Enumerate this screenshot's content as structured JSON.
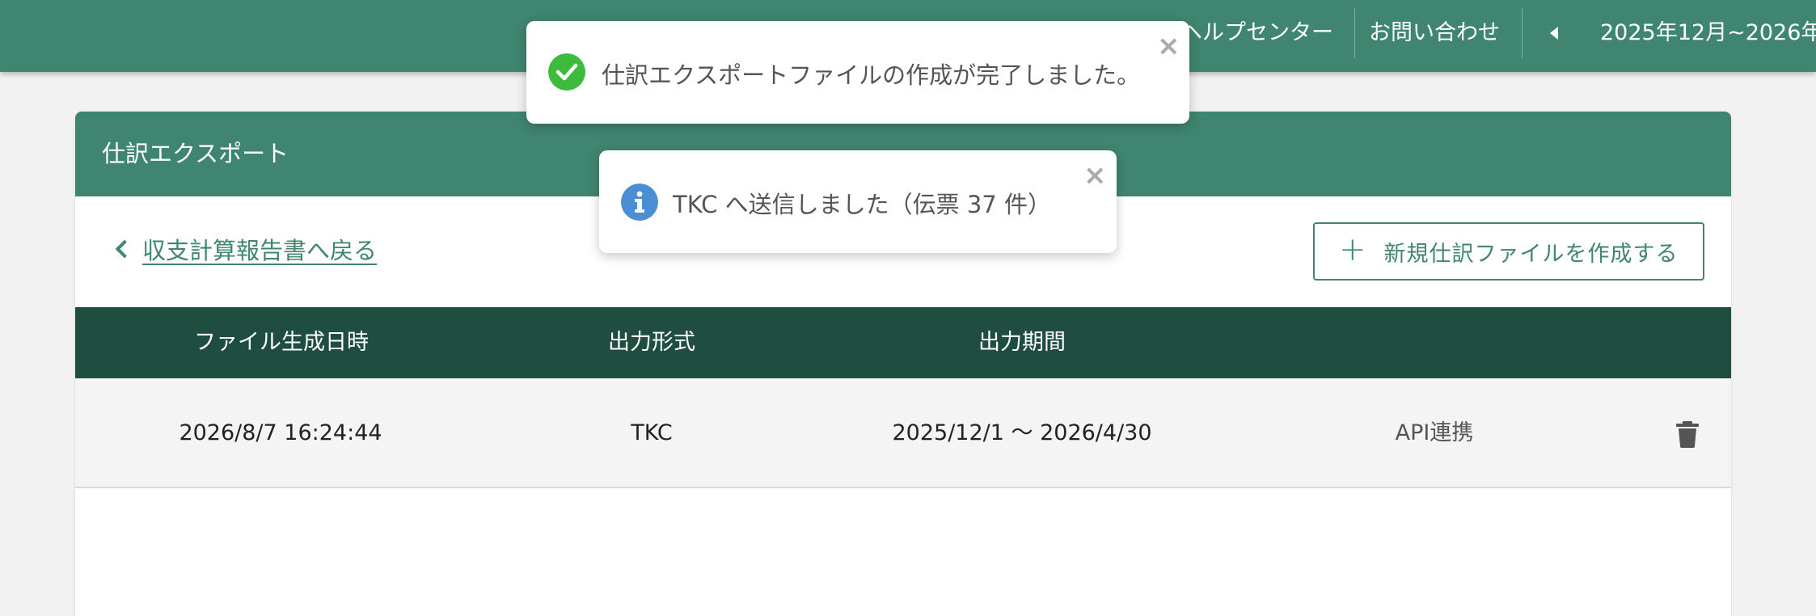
{
  "topbar": {
    "help_center": "ヘルプセンター",
    "contact": "お問い合わせ",
    "period": "2025年12月~2026年"
  },
  "card": {
    "title": "仕訳エクスポート",
    "back_link": "収支計算報告書へ戻る",
    "new_button": "新規仕訳ファイルを作成する"
  },
  "table": {
    "headers": [
      "ファイル生成日時",
      "出力形式",
      "出力期間"
    ],
    "rows": [
      {
        "created_at": "2026/8/7 16:24:44",
        "format": "TKC",
        "period": "2025/12/1 〜 2026/4/30",
        "method": "API連携"
      }
    ]
  },
  "toasts": {
    "success": "仕訳エクスポートファイルの作成が完了しました。",
    "info": "TKC へ送信しました（伝票 37 件）"
  },
  "colors": {
    "brand": "#3f8570",
    "table_header": "#1f4e41",
    "success": "#3dbb3d",
    "info": "#4a8fd4"
  },
  "icons": {
    "close": "close-icon",
    "success": "check-circle-icon",
    "info": "info-circle-icon",
    "delete": "trash-icon",
    "back": "chevron-left-icon",
    "add": "plus-icon",
    "prev_period": "caret-left-icon"
  }
}
